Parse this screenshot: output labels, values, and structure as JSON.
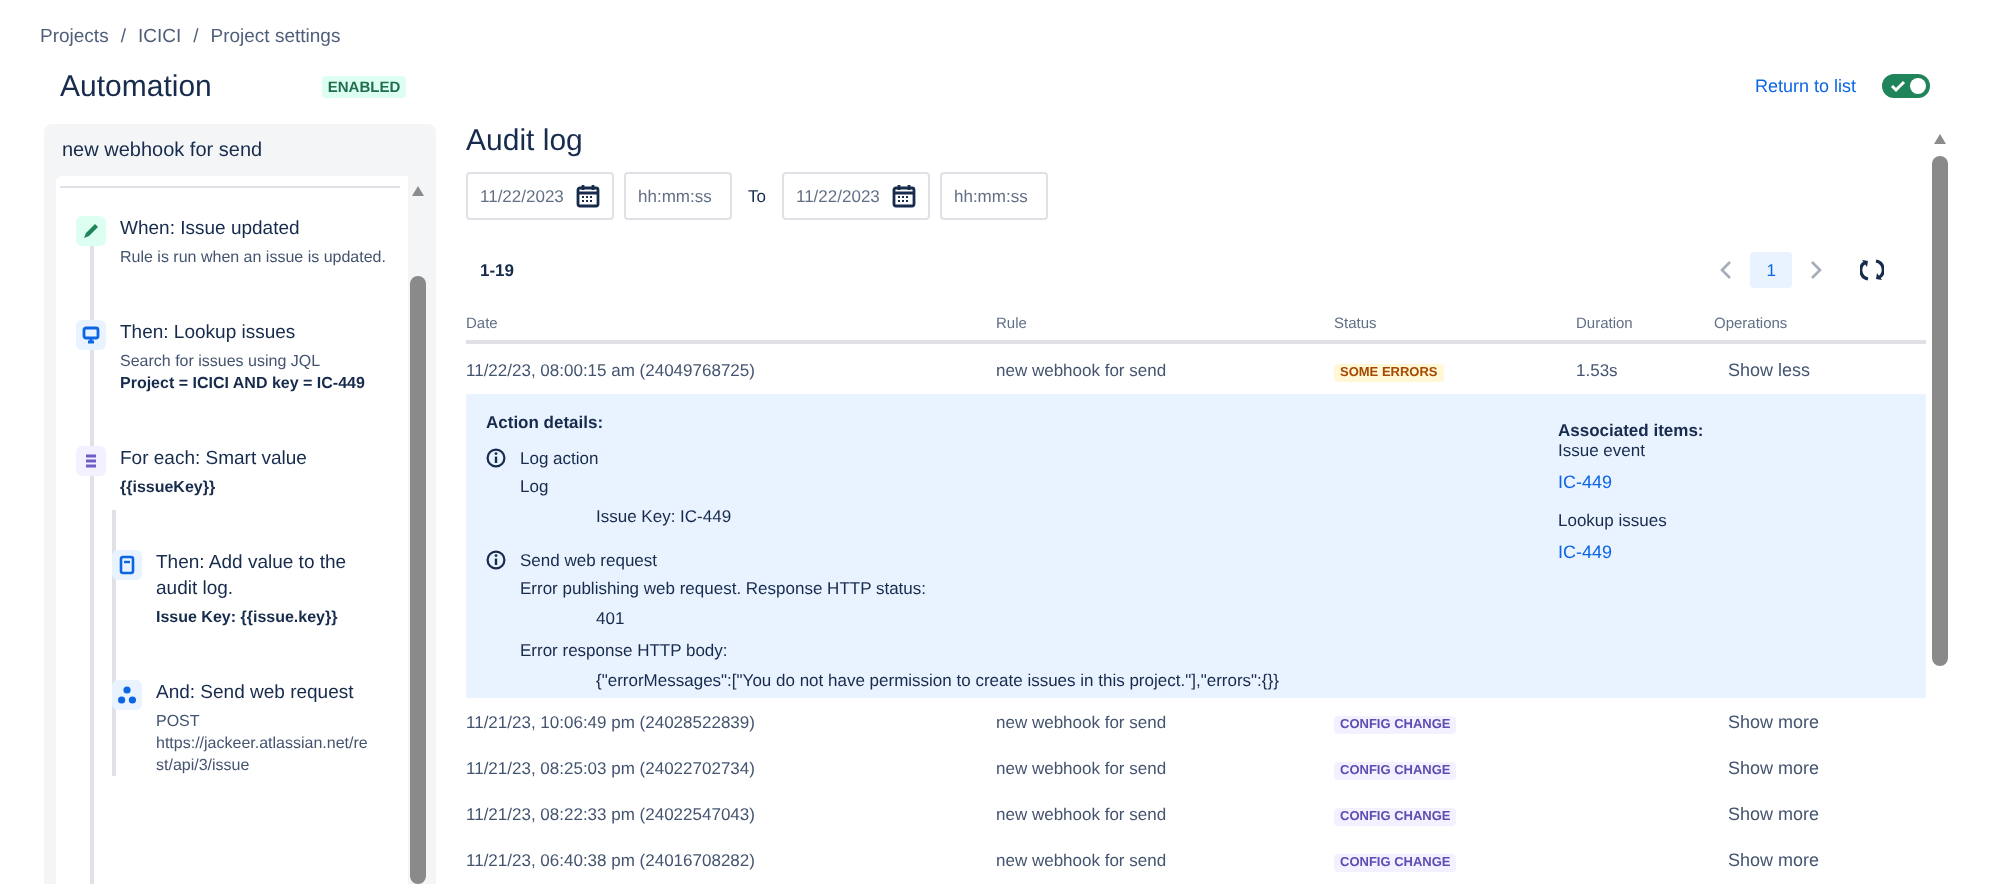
{
  "breadcrumb": {
    "separator": "/",
    "items": [
      "Projects",
      "ICICI",
      "Project settings"
    ]
  },
  "header": {
    "title": "Automation",
    "badge": "ENABLED",
    "return_link": "Return to list",
    "toggle": {
      "on": true
    }
  },
  "rule_panel": {
    "title": "new webhook for send",
    "steps": [
      {
        "kind": "trigger",
        "title": "When: Issue updated",
        "lines": [
          {
            "text": "Rule is run when an issue is updated.",
            "strong": false
          }
        ]
      },
      {
        "kind": "lookup",
        "title": "Then: Lookup issues",
        "lines": [
          {
            "text": "Search for issues using JQL",
            "strong": false
          },
          {
            "text": "Project = ICICI AND key = IC-449",
            "strong": true
          }
        ]
      },
      {
        "kind": "branch",
        "title": "For each: Smart value",
        "lines": [
          {
            "text": "{{issueKey}}",
            "strong": true
          }
        ],
        "children": [
          {
            "kind": "log",
            "title": "Then: Add value to the audit log.",
            "lines": [
              {
                "text": "Issue Key: {{issue.key}}",
                "strong": true
              }
            ]
          },
          {
            "kind": "webhook",
            "title": "And: Send web request",
            "lines": [
              {
                "text": "POST",
                "strong": false
              },
              {
                "text": "https://jackeer.atlassian.net/rest/api/3/issue",
                "strong": false
              }
            ]
          }
        ]
      }
    ]
  },
  "audit_log": {
    "title": "Audit log",
    "filters": {
      "from_date": "11/22/2023",
      "from_time": {
        "placeholder": "hh:mm:ss"
      },
      "to_label": "To",
      "to_date": "11/22/2023",
      "to_time": {
        "placeholder": "hh:mm:ss"
      }
    },
    "range": "1-19",
    "pager": {
      "pages": [
        {
          "label": "1",
          "selected": true
        }
      ]
    },
    "table": {
      "columns": [
        "Date",
        "Rule",
        "Status",
        "Duration",
        "Operations"
      ],
      "rows": [
        {
          "date": "11/22/23, 08:00:15 am (24049768725)",
          "rule": "new webhook for send",
          "status": {
            "kind": "error",
            "label": "SOME ERRORS"
          },
          "duration": "1.53s",
          "operation": "Show less",
          "details": {
            "heading": "Action details:",
            "actions": [
              {
                "title": "Log action",
                "lines": [
                  {
                    "text": "Log",
                    "children": [
                      {
                        "text": "Issue Key: IC-449"
                      }
                    ]
                  }
                ]
              },
              {
                "title": "Send web request",
                "lines": [
                  {
                    "text": "Error publishing web request. Response HTTP status:",
                    "children": [
                      {
                        "text": "401"
                      }
                    ]
                  },
                  {
                    "text": "Error response HTTP body:",
                    "children": [
                      {
                        "text": "{\"errorMessages\":[\"You do not have permission to create issues in this project.\"],\"errors\":{}}"
                      }
                    ]
                  }
                ]
              }
            ],
            "associated": {
              "heading": "Associated items:",
              "groups": [
                {
                  "label": "Issue event",
                  "links": [
                    "IC-449"
                  ]
                },
                {
                  "label": "Lookup issues",
                  "links": [
                    "IC-449"
                  ]
                }
              ]
            }
          }
        },
        {
          "date": "11/21/23, 10:06:49 pm (24028522839)",
          "rule": "new webhook for send",
          "status": {
            "kind": "config",
            "label": "CONFIG CHANGE"
          },
          "operation": "Show more"
        },
        {
          "date": "11/21/23, 08:25:03 pm (24022702734)",
          "rule": "new webhook for send",
          "status": {
            "kind": "config",
            "label": "CONFIG CHANGE"
          },
          "operation": "Show more"
        },
        {
          "date": "11/21/23, 08:22:33 pm (24022547043)",
          "rule": "new webhook for send",
          "status": {
            "kind": "config",
            "label": "CONFIG CHANGE"
          },
          "operation": "Show more"
        },
        {
          "date": "11/21/23, 06:40:38 pm (24016708282)",
          "rule": "new webhook for send",
          "status": {
            "kind": "config",
            "label": "CONFIG CHANGE"
          },
          "operation": "Show more"
        }
      ]
    }
  }
}
